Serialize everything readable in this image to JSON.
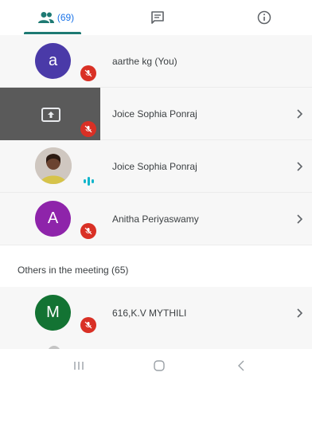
{
  "tabs": {
    "people_count": "(69)",
    "chat_icon": "chat-icon",
    "info_icon": "info-icon"
  },
  "participants": [
    {
      "name": "aarthe kg (You)",
      "avatar_letter": "a",
      "avatar_color": "#4285f4",
      "muted": true
    },
    {
      "name": "Joice Sophia Ponraj",
      "type": "screen-share",
      "muted": true
    },
    {
      "name": "Joice Sophia Ponraj",
      "type": "photo",
      "speaking": true
    },
    {
      "name": "Anitha Periyaswamy",
      "avatar_letter": "A",
      "avatar_color": "#8e24aa",
      "muted": true
    }
  ],
  "others": {
    "header": "Others in the meeting (65)",
    "items": [
      {
        "name": "616,K.V MYTHILI",
        "avatar_letter": "M",
        "avatar_color": "#137333",
        "muted": true
      }
    ]
  },
  "colors": {
    "accent": "#1e7a73",
    "mute_red": "#d93025",
    "speaking_teal": "#12b5cb"
  }
}
